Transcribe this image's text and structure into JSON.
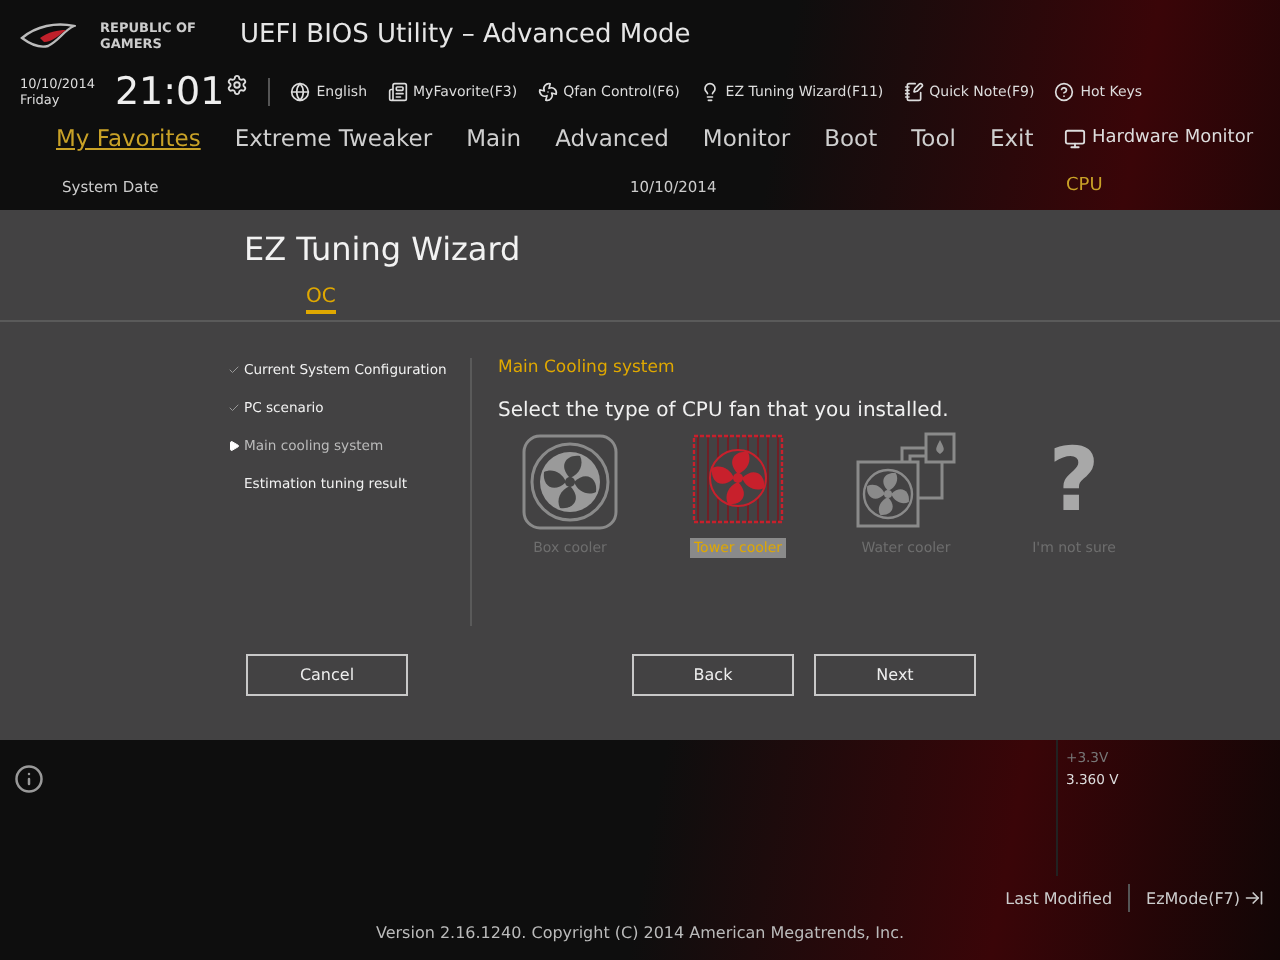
{
  "header": {
    "brand": "REPUBLIC OF GAMERS",
    "title": "UEFI BIOS Utility – Advanced Mode"
  },
  "clock": {
    "date": "10/10/2014",
    "day": "Friday",
    "time": "21:01"
  },
  "toolbar": [
    {
      "kind": "globe",
      "label": "English"
    },
    {
      "kind": "favorite",
      "label": "MyFavorite(F3)"
    },
    {
      "kind": "fan",
      "label": "Qfan Control(F6)"
    },
    {
      "kind": "bulb",
      "label": "EZ Tuning Wizard(F11)"
    },
    {
      "kind": "note",
      "label": "Quick Note(F9)"
    },
    {
      "kind": "help",
      "label": "Hot Keys"
    }
  ],
  "nav_tabs": [
    {
      "label": "My Favorites",
      "selected": true
    },
    {
      "label": "Extreme Tweaker",
      "selected": false
    },
    {
      "label": "Main",
      "selected": false
    },
    {
      "label": "Advanced",
      "selected": false
    },
    {
      "label": "Monitor",
      "selected": false
    },
    {
      "label": "Boot",
      "selected": false
    },
    {
      "label": "Tool",
      "selected": false
    },
    {
      "label": "Exit",
      "selected": false
    }
  ],
  "setting": {
    "label": "System Date",
    "value": "10/10/2014"
  },
  "hardware_monitor": {
    "title": "Hardware Monitor",
    "section": "CPU",
    "reading_label": "+3.3V",
    "reading_value": "3.360 V"
  },
  "wizard": {
    "title": "EZ Tuning Wizard",
    "tabs": [
      {
        "label": "OC",
        "selected": true
      }
    ],
    "steps": [
      {
        "label": "Current System Configuration",
        "done": true,
        "selected": false
      },
      {
        "label": "PC scenario",
        "done": true,
        "selected": false
      },
      {
        "label": "Main cooling system",
        "done": false,
        "selected": true
      },
      {
        "label": "Estimation tuning result",
        "done": false,
        "selected": false
      }
    ],
    "section_title": "Main Cooling system",
    "prompt": "Select the type of CPU fan that you installed.",
    "options": [
      {
        "kind": "box",
        "label": "Box cooler",
        "selected": false
      },
      {
        "kind": "tower",
        "label": "Tower cooler",
        "selected": true
      },
      {
        "kind": "water",
        "label": "Water cooler",
        "selected": false
      },
      {
        "kind": "unknown",
        "glyph": "?",
        "label": "I'm not sure",
        "selected": false
      }
    ],
    "buttons": {
      "cancel": "Cancel",
      "back": "Back",
      "next": "Next"
    }
  },
  "footer": {
    "last_modified": "Last Modified",
    "ez_mode": "EzMode(F7)",
    "version": "Version 2.16.1240. Copyright (C) 2014 American Megatrends, Inc."
  }
}
